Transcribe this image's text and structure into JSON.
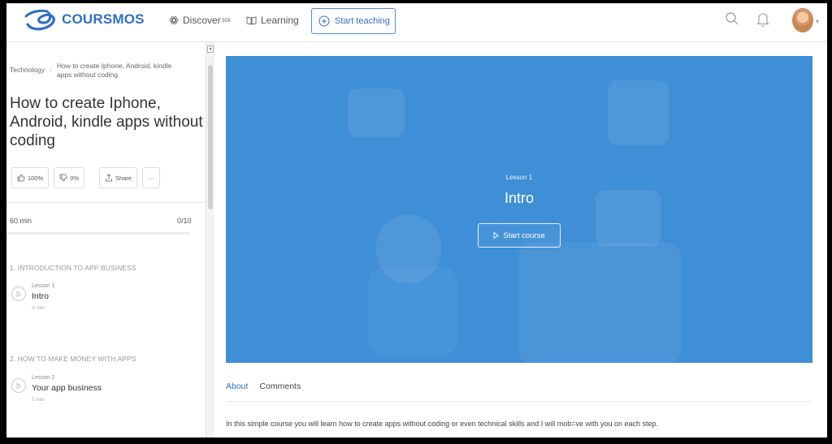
{
  "header": {
    "logo_text": "COURSMOS",
    "nav": {
      "discover_label": "Discover",
      "discover_count": "30k",
      "learning_label": "Learning",
      "start_teaching_label": "Start teaching"
    },
    "icons": [
      "search-icon",
      "bell-icon",
      "avatar"
    ]
  },
  "sidebar": {
    "breadcrumb_category": "Technology",
    "breadcrumb_course": "How to create Iphone, Android, kindle apps without coding",
    "course_title": "How to create Iphone, Android, kindle apps without coding",
    "reactions": {
      "like": "100%",
      "dislike": "0%",
      "share": "Share",
      "more": "···"
    },
    "duration": "60 min",
    "progress_text": "0/10",
    "progress_fraction": 0.0,
    "sections": [
      {
        "title": "1. INTRODUCTION TO APP BUSINESS",
        "lesson": {
          "label": "Lesson 1",
          "name": "Intro",
          "time": "3 min"
        }
      },
      {
        "title": "2. HOW TO MAKE MONEY WITH APPS",
        "lesson": {
          "label": "Lesson 2",
          "name": "Your app business",
          "time": "5 min"
        }
      }
    ]
  },
  "hero": {
    "lesson_label": "Lesson 1",
    "title": "Intro",
    "start_course_label": "Start course",
    "background_color": "#3f8fd6"
  },
  "tabs": [
    {
      "label": "About",
      "active": true
    },
    {
      "label": "Comments",
      "active": false
    }
  ],
  "description": "In this simple course you will learn how to create apps without coding or even technical skills and I will mob=ve with you on each step.",
  "colors": {
    "accent": "#2f6fc7",
    "hero": "#3f8fd6"
  }
}
